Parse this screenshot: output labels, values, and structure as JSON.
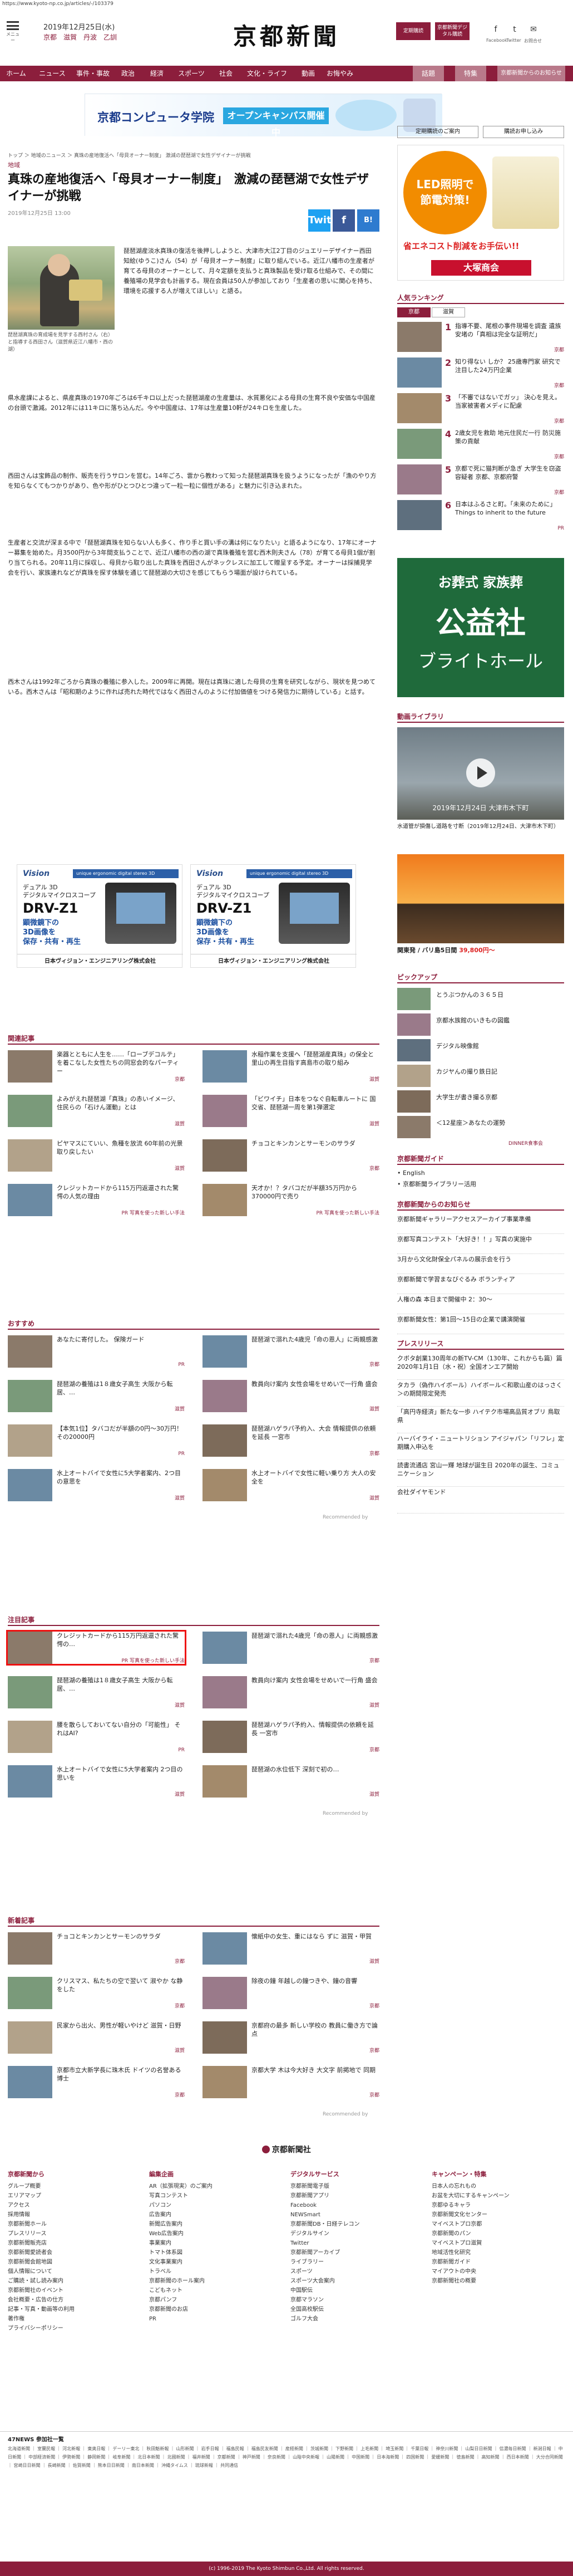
{
  "url": "https://www.kyoto-np.co.jp/articles/-/103379",
  "header": {
    "menu_label": "メニュー",
    "date": "2019年12月25日(水)",
    "regions": [
      "京都",
      "滋賀",
      "丹波",
      "乙訓"
    ],
    "logo": "京都新聞",
    "btn_members": "定期購読",
    "btn_digital": "京都新聞デジタル購読",
    "social": [
      "f",
      "t",
      "✉"
    ],
    "social_labels": [
      "Facebook",
      "Twitter",
      "お問合せ"
    ]
  },
  "nav": {
    "items": [
      "ホーム",
      "ニュース",
      "事件・事故",
      "政治",
      "経済",
      "スポーツ",
      "社会",
      "文化・ライフ",
      "動画",
      "お悔やみ"
    ],
    "alt": [
      "話題",
      "特集",
      "京都新聞からのお知らせ"
    ]
  },
  "banner": {
    "school": "京都コンピュータ学院",
    "cta": "オープンキャンパス開催中"
  },
  "breadcrumb": "トップ ＞ 地域のニュース ＞ 真珠の産地復活へ「母貝オーナー制度」 激減の琵琶湖で女性デザイナーが挑戦",
  "article": {
    "area": "地域",
    "title": "真珠の産地復活へ「母貝オーナー制度」　激減の琵琶湖で女性デザイナーが挑戦",
    "date": "2019年12月25日 13:00",
    "share": [
      "Twitter",
      "f",
      "B!"
    ],
    "caption": "琵琶湖真珠の育成場を見学する西村さん（右）と指導する西田さん（滋賀県近江八幡市・西の湖）",
    "p1": "琵琶湖産淡水真珠の復活を後押ししようと、大津市大江2丁目のジュエリーデザイナー西田知絵(ゆうこ)さん（54）が「母貝オーナー制度」に取り組んでいる。近江八幡市の生産者が育てる母貝のオーナーとして、月々定額を支払うと真珠製品を受け取る仕組みで、その間に養殖場の見学会も計画する。現在会員は50人が参加しており「生産者の思いに関心を持ち、環境を応援する人が増えてほしい」と語る。",
    "p2": "県水産課によると、県産真珠の1970年ごろは6千キロ以上だった琵琶湖産の生産量は、水質悪化による母貝の生育不良や安価な中国産の台頭で激減。2012年には11キロに落ち込んだ。今や中国産は、17年は生産量10軒が24キロを生産した。",
    "p3": "西田さんは宝飾品の制作、販売を行うサロンを営む。14年ごろ、雲から教わって知った琵琶湖真珠を扱うようになったが「漁のやり方を知らなくてもつかりがあり、色や形がひとつひとつ違って一粒一粒に個性がある」と魅力に引き込まれた。",
    "p4": "生産者と交流が深まる中で「琵琶湖真珠を知らない人も多く、作り手と買い手の溝は何になりたい」と語るようになり、17年にオーナー募集を始めた。月3500円から3年間支払うことで、近江八幡市の西の湖で真珠養殖を営む西木則夫さん（78）が育てる母貝1個が割り当てられる。20年11月に採収し、母貝から取り出した真珠を西田さんがネックレスに加工して贈呈する予定。オーナーは採捕見学会を行い、家族連れなどが真珠を探す体験を通じて琵琶湖の大切さを感じてもらう場面が設けられている。",
    "p5": "西木さんは1992年ごろから真珠の養殖に参入した。2009年に再開。現在は真珠に適した母貝の生育を研究しながら、現状を見つめている。西木さんは「昭和期のように作れば売れた時代ではなく西田さんのように付加価値をつける発信力に期待している」と話す。"
  },
  "ad_mid": {
    "logo": "Vision",
    "tag": "unique ergonomic digital stereo 3D",
    "jp": "デュアル 3D\nデジタルマイクロスコープ",
    "model": "DRV-Z1",
    "blue": "顕微鏡下の\n3D画像を\n保存・共有・再生",
    "company": "日本ヴィジョン・エンジニアリング株式会社"
  },
  "related": {
    "title": "関連記事",
    "items": [
      {
        "t": "楽器とともに人生を……「ローブデコルテ」を着こなした女性たちの同窓会的なパーティー",
        "c": "京都"
      },
      {
        "t": "水稲作業を支援へ「琵琶湖産真珠」の保全と里山の再生目指す高島市の取り組み",
        "c": "滋賀"
      },
      {
        "t": "よみがえれ琵琶湖「真珠」の赤いイメージ、住民らの「石けん運動」とは",
        "c": "滋賀"
      },
      {
        "t": "「ビワイチ」日本をつなぐ自転車ルートに 国交省、琵琶湖一周を第1弾選定",
        "c": "滋賀"
      },
      {
        "t": "ピヤマスにていい、魚種を放流 60年前の光景取り戻したい",
        "c": "滋賀"
      },
      {
        "t": "チョコとキンカンとサーモンのサラダ",
        "c": "京都"
      },
      {
        "t": "クレジットカードから115万円返還された驚愕の人気の理由",
        "c": "PR 写真を使った新しい手法"
      },
      {
        "t": "天才か！？タバコだが半額35万円から370000円で売り",
        "c": "PR 写真を使った新しい手法"
      }
    ]
  },
  "osusume": {
    "title": "おすすめ",
    "items": [
      {
        "t": "あなたに寄付した。 保険ガード",
        "c": "PR"
      },
      {
        "t": "琵琶湖で溺れた4歳児「命の恩人」に両親感激",
        "c": "京都"
      },
      {
        "t": "琵琶湖の養殖は1８歳女子高生 大阪から転居、…",
        "c": "滋賀"
      },
      {
        "t": "教員向け案内 女性会場をせめいで一行角 盛会",
        "c": "滋賀"
      },
      {
        "t": "【本気1位】タバコだが半額の0円〜30万円！その20000円",
        "c": "PR"
      },
      {
        "t": "琵琶湖ハゲラパ予約入、大会 情報提供の依頼を延長 一宮市",
        "c": "京都"
      },
      {
        "t": "水上オートバイで女性に5大学者案内、2つ目の意思を",
        "c": "滋賀"
      },
      {
        "t": "水上オートバイで女性に軽い乗り方 大人の安全を",
        "c": "滋賀"
      }
    ]
  },
  "chumoku": {
    "title": "注目記事",
    "items": [
      {
        "t": "クレジットカードから115万円返還された驚愕の…",
        "c": "PR 写真を使った新しい手法"
      },
      {
        "t": "琵琶湖で溺れた4歳児「命の恩人」に両親感激",
        "c": "京都"
      },
      {
        "t": "琵琶湖の養殖は1８歳女子高生 大阪から転居、…",
        "c": "滋賀"
      },
      {
        "t": "教員向け案内 女性会場をせめいで一行角 盛会",
        "c": "滋賀"
      },
      {
        "t": "腰を散らしておいてない自分の「可能性」 それはAI?",
        "c": "PR"
      },
      {
        "t": "琵琶湖ハゲラパ予約入、情報提供の依頼を延長 一宮市",
        "c": "京都"
      },
      {
        "t": "水上オートバイで女性に5大学者案内 2つ目の思いを",
        "c": "滋賀"
      },
      {
        "t": "琵琶湖の水位低下 深刻で初の…",
        "c": "滋賀"
      }
    ]
  },
  "shinchaku": {
    "title": "新着記事",
    "items": [
      {
        "t": "チョコとキンカンとサーモンのサラダ",
        "c": "京都"
      },
      {
        "t": "懐紙中の女生、重にはなら ずに 滋賀・甲賀",
        "c": "滋賀"
      },
      {
        "t": "クリスマス、私たちの空で翌いて 淑やか な静をした",
        "c": "京都"
      },
      {
        "t": "除夜の鐘 年越しの鐘つきや、鐘の音響",
        "c": "京都"
      },
      {
        "t": "民家から出火、男性が軽いやけど 滋賀・日野",
        "c": "滋賀"
      },
      {
        "t": "京都府の最多 新しい学校の 教員に働き方で論点",
        "c": "京都"
      },
      {
        "t": "京都市立大新学長に珠木氏 ドイツの名誉ある博士",
        "c": "京都"
      },
      {
        "t": "京都大学 木は今大好き 大文字 前掲地で 同期",
        "c": "京都"
      }
    ]
  },
  "side": {
    "ad_top": {
      "l1": "LED照明で",
      "l2": "節電対策!",
      "l3": "省エネコスト削減をお手伝い!!",
      "co": "大塚商会"
    },
    "ranking_title": "人気ランキング",
    "ranking_tabs": [
      "京都",
      "滋賀"
    ],
    "ranking": [
      {
        "n": "1",
        "t": "指導不要、尾根の事件現場を調査 遺族安堵の「真相は完全な証明だ」",
        "c": "京都"
      },
      {
        "n": "2",
        "t": "知り得ない しか？ 25歳専門家 研究で注目した24万円企業",
        "c": "京都"
      },
      {
        "n": "3",
        "t": "「不審ではないでガッ」 決心を見え。当家被害者メディに配慮",
        "c": "京都"
      },
      {
        "n": "4",
        "t": "2歳女児を救助 地元住民だ一行 防災施策の貢献",
        "c": "京都"
      },
      {
        "n": "5",
        "t": "京都で死に猫判断が急ぎ 大学生を窃盗容疑者 京都、京都府警",
        "c": "京都"
      },
      {
        "n": "6",
        "t": "日本はふるさと町。「未来のために」Things to inherit to the future",
        "c": "PR"
      }
    ],
    "ad_funeral": {
      "l1": "お葬式 家族葬",
      "l2": "公益社",
      "l3": "ブライトホール"
    },
    "video_title": "動画ライブラリ",
    "video_cap": "水道管が損傷し道路を寸断（2019年12月24日、大津市木下町）",
    "video_overlay": "2019年12月24日 大津市木下町",
    "bali": {
      "l1": "関東発 / バリ島5日間",
      "l2": "39,800円〜"
    },
    "pick_title": "ピックアップ",
    "pick": [
      "とうぶつかんの３６５日",
      "京都水族館のいきもの図鑑",
      "デジタル映像館",
      "カジヤんの撮り鉄日記",
      "大学生が書き撮る京都",
      "＜12星座＞あなたの運勢"
    ],
    "dinner": "DINNER食事会",
    "guide_title": "京都新聞ガイド",
    "guide": [
      "English",
      "京都新聞ライブラリー活用"
    ],
    "notice_title": "京都新聞からのお知らせ",
    "notice": [
      "京都新聞ギャラリーアクセスアーカイブ事業準備",
      "京都写真コンテスト「大好き！！」写真の実施中",
      "3月から文化財保全パネルの展示会を行う",
      "京都新聞で学習まなびぐるみ ボランティア",
      "人権の森 本日まで開催中 2：30〜",
      "京都新聞女性：第1回～15日の企業で講演開催"
    ],
    "press_title": "プレスリリース",
    "press": [
      "クボタ創業130周年の新TV-CM（130年、これからも篇）篇 2020年1月1日（水・祝）全国オンエア開始",
      "タカラ（偽作ハイボール）ハイボール＜和歌山産のはっさく＞の期間限定発売",
      "「高円寺経済」新たな一歩 ハイテク市場高品質オブリ 鳥取県",
      "ハーバイライ・ニュートリション アイジャパン「リフレ」定期購入申込を",
      "読書流通店 宮山一輝 地球が誕生日 2020年の誕生、コミュニケーション",
      "会社ダイヤモンド"
    ]
  },
  "footer": {
    "company": "京都新聞社",
    "cols": [
      {
        "h": "京都新聞から",
        "i": [
          "グループ概要",
          "エリアマップ",
          "アクセス",
          "採用情報",
          "京都新聞ホール",
          "プレスリリース",
          "京都新聞販売店",
          "京都新聞愛読者会",
          "京都新聞会館地図",
          "個人情報について",
          "ご購読・試し読み案内",
          "京都新聞社のイベント",
          "会社概要・広告の仕方",
          "記事・写真・動画等の利用",
          "著作権",
          "プライバシーポリシー"
        ]
      },
      {
        "h": "編集企画",
        "i": [
          "AR（拡張現実）のご案内",
          "写真コンテスト",
          "パソコン",
          "広告案内",
          "新聞広告案内",
          "Web広告案内",
          "事業案内",
          "トマト体系図",
          "文化事業案内",
          "トラベル",
          "京都新聞のホール案内",
          "こどもネット",
          "京都パンフ",
          "京都新聞のお店",
          "PR"
        ]
      },
      {
        "h": "デジタルサービス",
        "i": [
          "京都新聞電子版",
          "京都新聞アプリ",
          "Facebook",
          "NEWSmart",
          "京都新聞DB・日経テレコン",
          "デジタルサイン",
          "Twitter",
          "京都新聞アーカイブ",
          "ライブラリー",
          "スポーツ",
          "スポーツ大会案内",
          "中国駅伝",
          "京都マラソン",
          "全国高校駅伝",
          "ゴルフ大会"
        ]
      },
      {
        "h": "キャンペーン・特集",
        "i": [
          "日本人の忘れもの",
          "お盆を大切にするキャンペーン",
          "京都ゆるキャラ",
          "京都新聞文化センター",
          "マイベストプロ京都",
          "京都新聞のパン",
          "マイベストプロ滋賀",
          "地域活性化研究",
          "京都新聞ガイド",
          "マイアウトの中央",
          "京都新聞社の概要"
        ]
      }
    ],
    "news47_title": "47NEWS 参加社一覧",
    "news47": "北海道新聞 ｜ 室蘭民報 ｜ 河北新報 ｜ 東奥日報 ｜ デーリー東北 ｜ 秋田魁新報 ｜ 山形新聞 ｜ 岩手日報 ｜ 福島民報 ｜ 福島民友新聞 ｜ 産経新聞 ｜ 茨城新聞 ｜ 下野新聞 ｜ 上毛新聞 ｜ 埼玉新聞 ｜ 千葉日報 ｜ 神奈川新聞 ｜ 山梨日日新聞 ｜ 信濃毎日新聞 ｜ 新潟日報 ｜ 中日新聞 ｜ 中部経済新聞 ｜ 伊勢新聞 ｜ 静岡新聞 ｜ 岐阜新聞 ｜ 北日本新聞 ｜ 北國新聞 ｜ 福井新聞 ｜ 京都新聞 ｜ 神戸新聞 ｜ 奈良新聞 ｜ 山陰中央新報 ｜ 山陽新聞 ｜ 中国新聞 ｜ 日本海新聞 ｜ 四国新聞 ｜ 愛媛新聞 ｜ 徳島新聞 ｜ 高知新聞 ｜ 西日本新聞 ｜ 大分合同新聞 ｜ 宮崎日日新聞 ｜ 長崎新聞 ｜ 佐賀新聞 ｜ 熊本日日新聞 ｜ 南日本新聞 ｜ 沖縄タイムス ｜ 琉球新報 ｜ 共同通信",
    "copyright": "(c) 1996-2019 The Kyoto Shimbun Co.,Ltd. All rights reserved."
  },
  "recommended": "Recommended by",
  "more_btns": [
    "定期購読のご案内",
    "購読お申し込み"
  ]
}
